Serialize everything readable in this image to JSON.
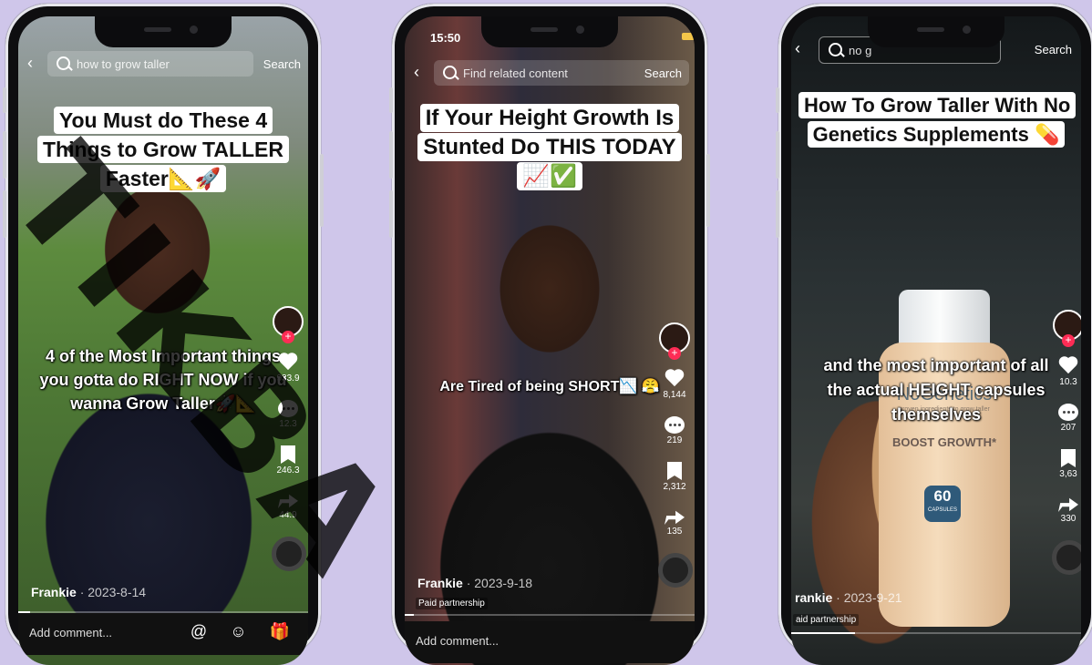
{
  "phones": [
    {
      "search_text": "how to grow taller",
      "search_label": "Search",
      "title": "You Must do These 4 Things to Grow TALLER Faster📐🚀",
      "caption": "4 of the Most Important things you gotta do RIGHT NOW if you wanna Grow Taller🚀📐",
      "author": "Frankie",
      "date": "· 2023-8-14",
      "likes": "933.9",
      "comments": "12.3",
      "saves": "246.3",
      "shares": "44.9",
      "comment_placeholder": "Add comment...",
      "comment_icons": "@ ☺ 🎁"
    },
    {
      "status_time": "15:50",
      "search_text": "Find related content",
      "search_label": "Search",
      "title": "If Your Height Growth Is Stunted Do THIS TODAY📈✅",
      "caption": "Are Tired of being SHORT📉 😤",
      "author": "Frankie",
      "date": "· 2023-9-18",
      "paid": "Paid partnership",
      "likes": "8,144",
      "comments": "219",
      "saves": "2,312",
      "shares": "135",
      "comment_placeholder": "Add comment..."
    },
    {
      "search_text": "no g",
      "search_label": "Search",
      "title": "How To Grow Taller With No Genetics Supplements 💊",
      "caption": "and the most important of all the actual HEIGHT capsules themselves",
      "author": "rankie",
      "date": "· 2023-9-21",
      "paid": "aid partnership",
      "likes": "10.3",
      "comments": "207",
      "saves": "3,63",
      "shares": "330",
      "bottle_brand": "NoGenetics",
      "bottle_tag": "proven ingredients to grow taller",
      "bottle_boost": "BOOST GROWTH*",
      "bottle_count": "60",
      "bottle_unit": "CAPSULES"
    }
  ],
  "watermark": "TIKBA"
}
